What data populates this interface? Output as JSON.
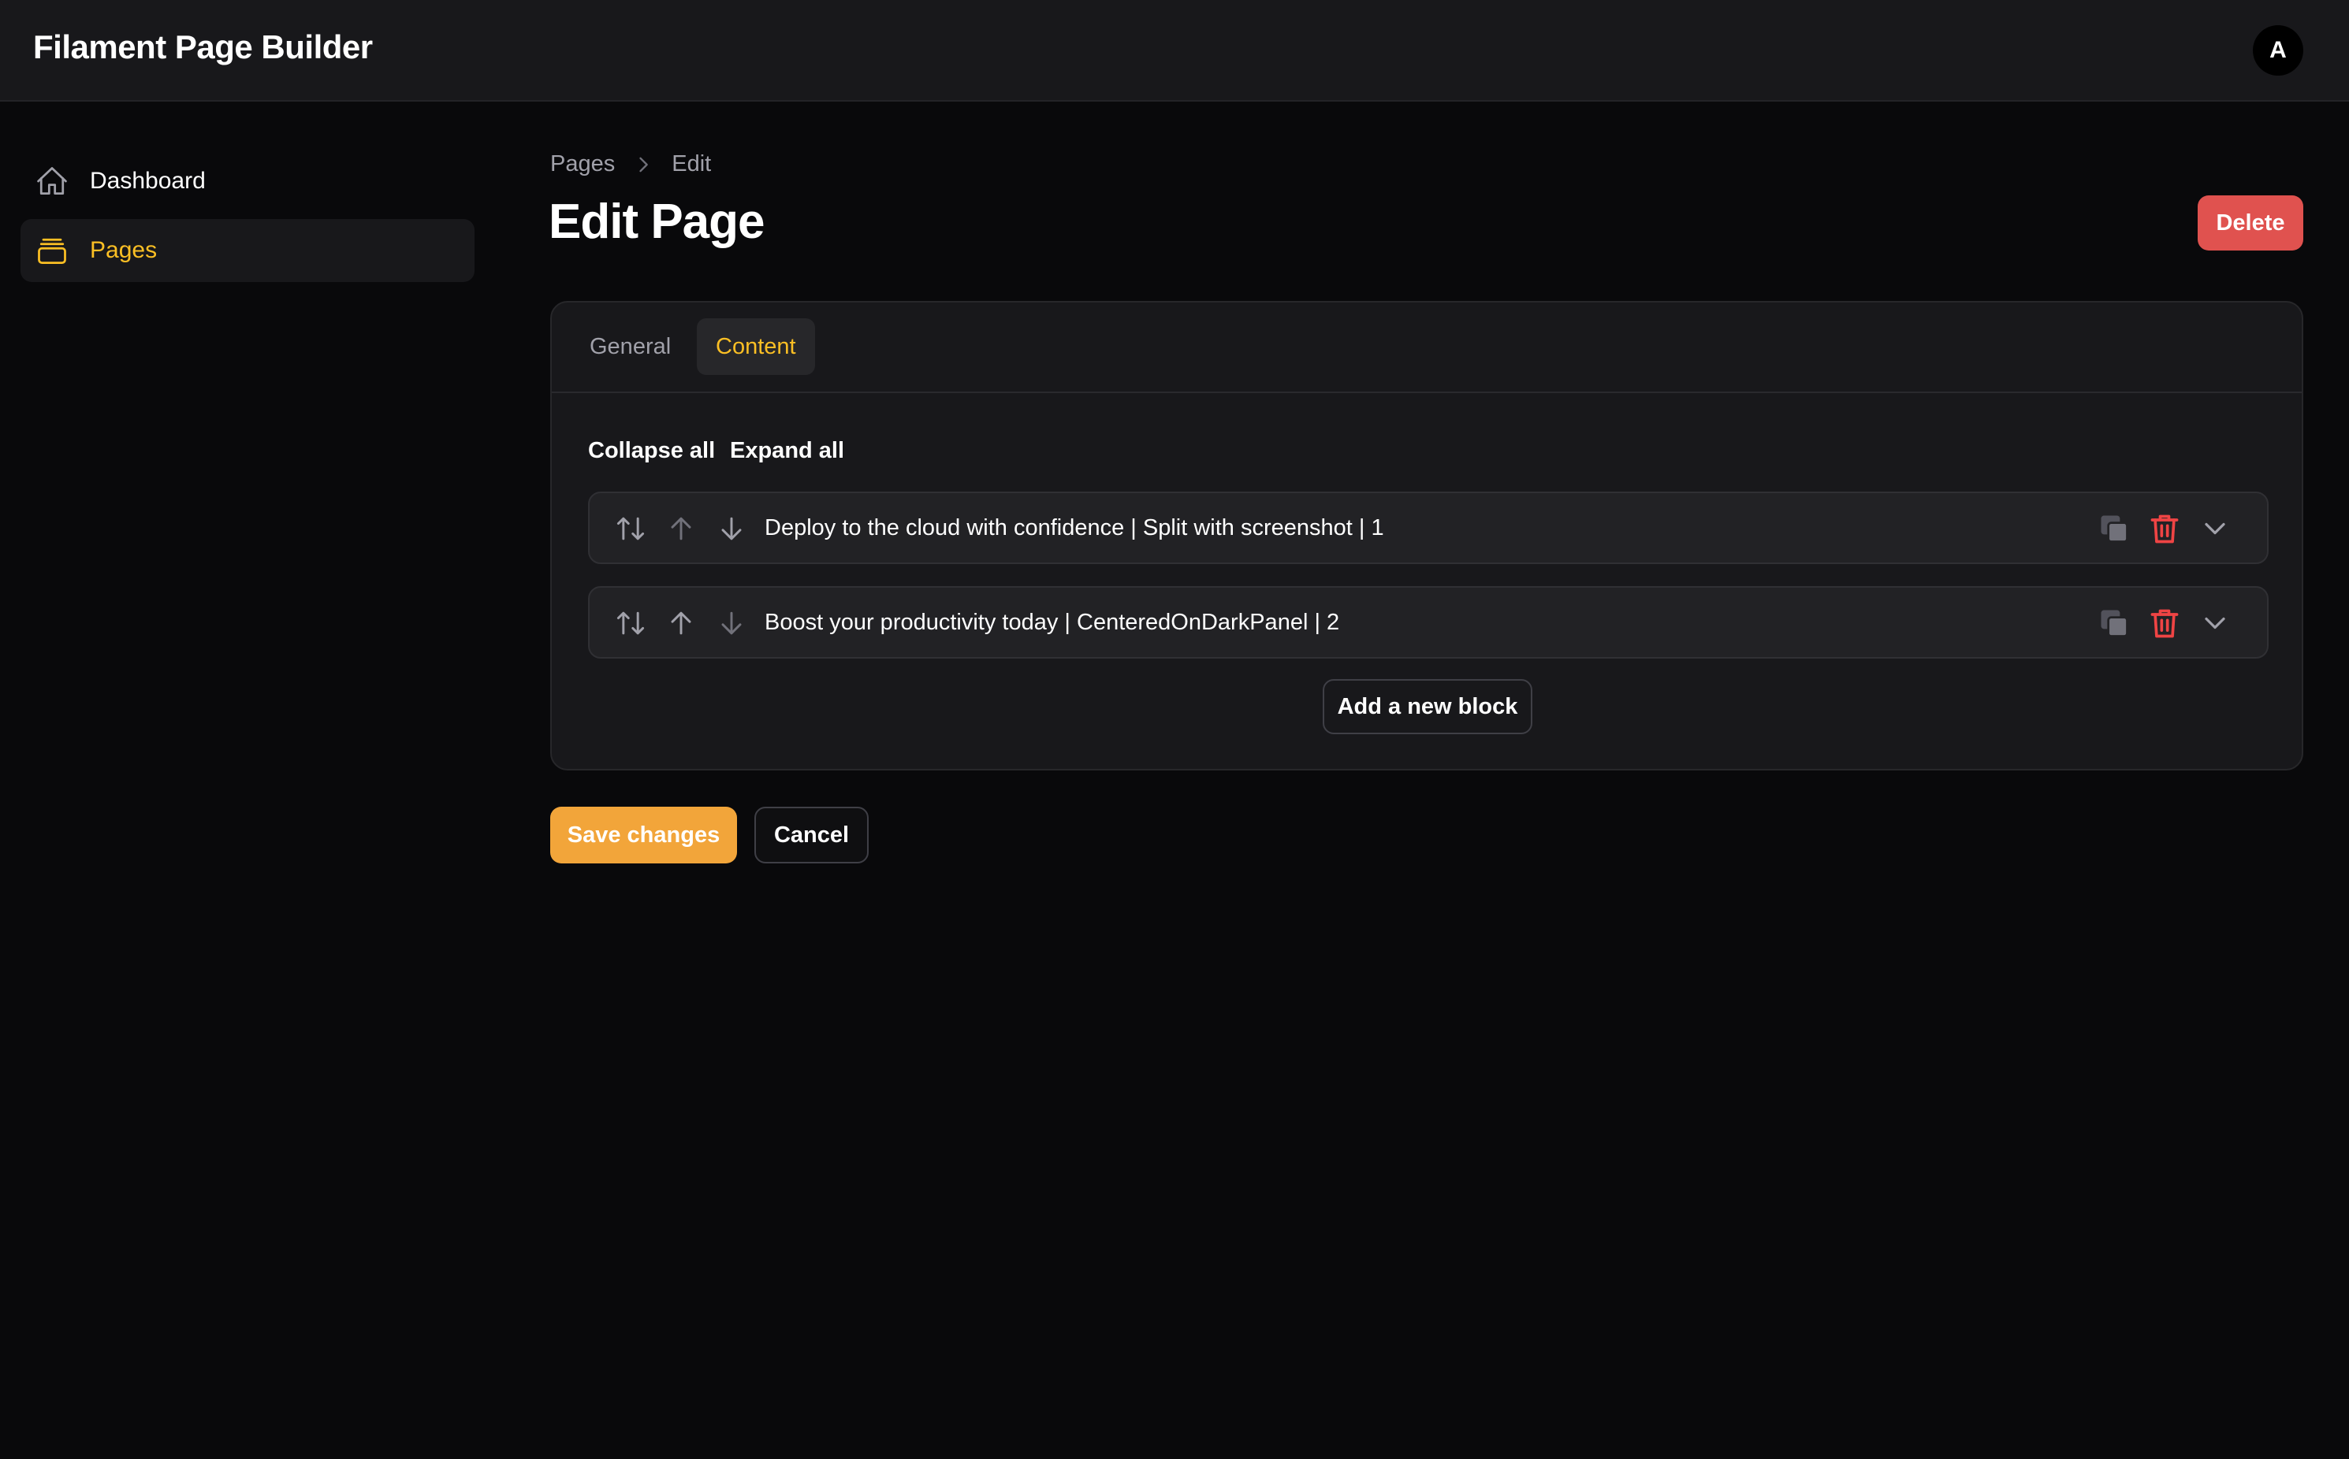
{
  "app": {
    "title": "Filament Page Builder",
    "avatar_initial": "A"
  },
  "sidebar": {
    "items": [
      {
        "label": "Dashboard",
        "icon": "home-icon",
        "active": false
      },
      {
        "label": "Pages",
        "icon": "rectangle-stack-icon",
        "active": true
      }
    ]
  },
  "breadcrumb": {
    "items": [
      "Pages",
      "Edit"
    ]
  },
  "header": {
    "title": "Edit Page",
    "delete_label": "Delete"
  },
  "tabs": [
    {
      "label": "General",
      "active": false
    },
    {
      "label": "Content",
      "active": true
    }
  ],
  "builder": {
    "collapse_all_label": "Collapse all",
    "expand_all_label": "Expand all",
    "blocks": [
      {
        "title": "Deploy to the cloud with confidence | Split with screenshot | 1"
      },
      {
        "title": "Boost your productivity today | CenteredOnDarkPanel | 2"
      }
    ],
    "add_block_label": "Add a new block"
  },
  "form_actions": {
    "save_label": "Save changes",
    "cancel_label": "Cancel"
  },
  "colors": {
    "accent": "#fbbf24",
    "primary_button": "#f2a53a",
    "danger": "#e0524f",
    "background": "#09090b",
    "surface": "#18181b"
  }
}
